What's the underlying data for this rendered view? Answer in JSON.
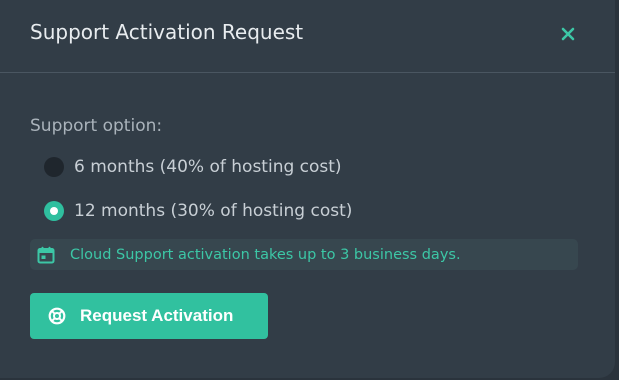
{
  "dialog": {
    "title": "Support Activation Request",
    "close_icon": "close-icon"
  },
  "form": {
    "support_option_label": "Support option:",
    "options": [
      {
        "label": "6 months (40% of hosting cost)",
        "selected": false
      },
      {
        "label": "12 months (30% of hosting cost)",
        "selected": true
      }
    ]
  },
  "info": {
    "icon": "calendar-icon",
    "text": "Cloud Support activation takes up to 3 business days."
  },
  "actions": {
    "request_icon": "lifebuoy-icon",
    "request_label": "Request Activation"
  },
  "colors": {
    "accent": "#31c19f",
    "background": "#323d47",
    "info_text": "#3cc7a6"
  }
}
